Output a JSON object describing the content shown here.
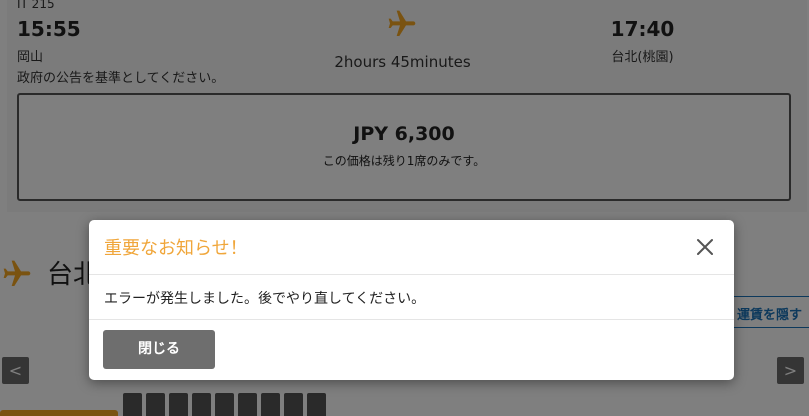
{
  "flight": {
    "number": "IT 215",
    "departure_time": "15:55",
    "departure_city": "岡山",
    "notice": "政府の公告を基準としてください。",
    "duration": "2hours 45minutes",
    "arrival_time": "17:40",
    "arrival_city": "台北(桃園)"
  },
  "fare": {
    "price": "JPY 6,300",
    "remaining": "この価格は残り1席のみです。"
  },
  "route_section": {
    "title": "台北",
    "hide_fare_label": "運賃を隠す",
    "prev_arrow": "<",
    "next_arrow": ">"
  },
  "modal": {
    "title": "重要なお知らせ！",
    "message": "エラーが発生しました。後でやり直してください。",
    "close_button_label": "閉じる"
  },
  "colors": {
    "accent_orange": "#f0a63a",
    "modal_button_gray": "#6e6e6e",
    "link_blue": "#1a73b8"
  },
  "icons": {
    "flight": "airplane-icon",
    "close": "close-icon"
  }
}
